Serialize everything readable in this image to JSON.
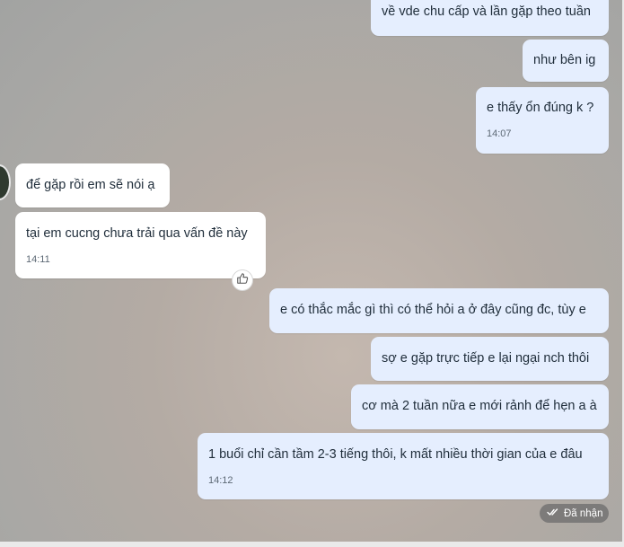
{
  "messages": {
    "m1": {
      "text": "về vde chu cấp và lần gặp theo tuần"
    },
    "m2": {
      "text": "như bên ig"
    },
    "m3": {
      "text": "e thấy ổn đúng k ?",
      "time": "14:07"
    },
    "m4": {
      "text": "để gặp rồi em sẽ nói ạ"
    },
    "m5": {
      "text": "tại em cucng chưa trải qua vấn đề này",
      "time": "14:11"
    },
    "m6": {
      "text": "e có thắc mắc gì thì có thể hỏi a ở đây cũng đc, tùy e"
    },
    "m7": {
      "text": "sợ e gặp trực tiếp e lại ngại nch thôi"
    },
    "m8": {
      "text": "cơ mà 2 tuần nữa e mới rảnh để hẹn a à"
    },
    "m9": {
      "text": "1 buổi chỉ cần tầm 2-3 tiếng thôi, k mất nhiều thời gian của e đâu",
      "time": "14:12"
    }
  },
  "reaction": {
    "icon": "thumbs-up-icon"
  },
  "status": {
    "label": "Đã nhận",
    "icon": "double-check-icon"
  },
  "colors": {
    "outgoing_bubble": "#e5eefe",
    "incoming_bubble": "#ffffff",
    "status_pill": "#696969"
  }
}
